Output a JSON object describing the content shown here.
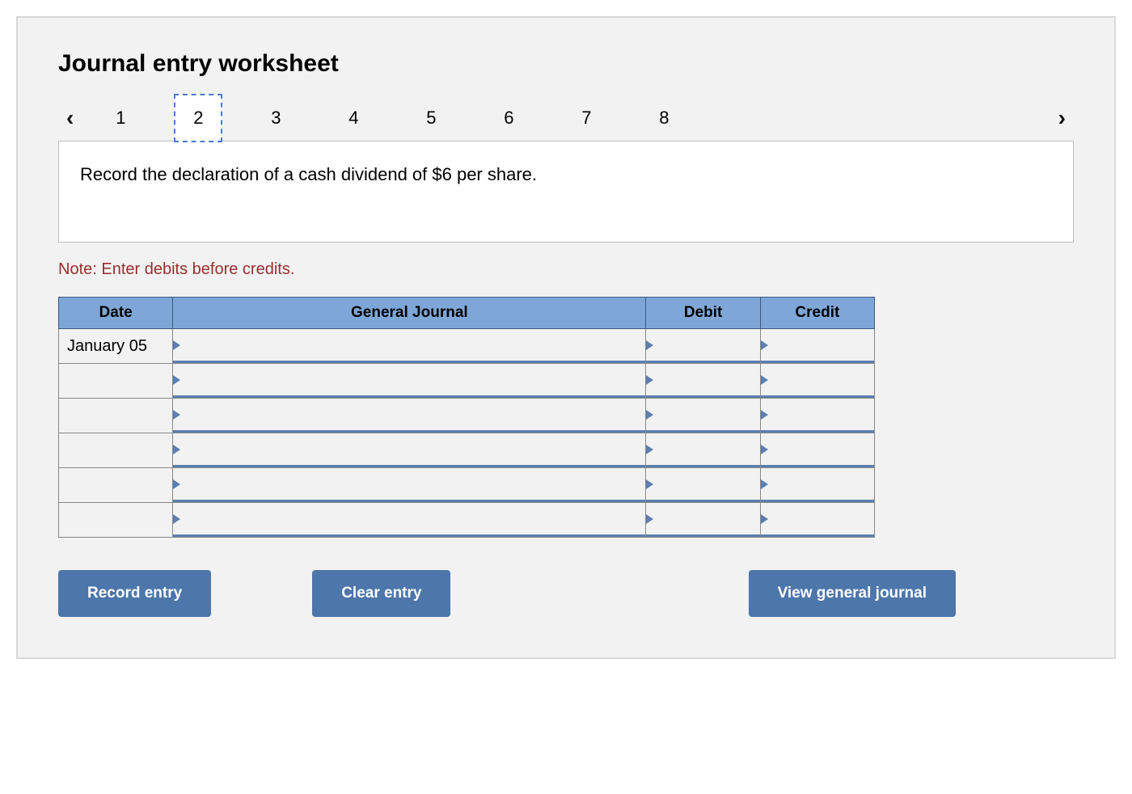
{
  "title": "Journal entry worksheet",
  "nav": {
    "steps": [
      "1",
      "2",
      "3",
      "4",
      "5",
      "6",
      "7",
      "8"
    ],
    "active_index": 1
  },
  "prompt": "Record the declaration of a cash dividend of $6 per share.",
  "note": "Note: Enter debits before credits.",
  "table": {
    "headers": {
      "date": "Date",
      "journal": "General Journal",
      "debit": "Debit",
      "credit": "Credit"
    },
    "rows": [
      {
        "date": "January 05",
        "journal": "",
        "debit": "",
        "credit": ""
      },
      {
        "date": "",
        "journal": "",
        "debit": "",
        "credit": ""
      },
      {
        "date": "",
        "journal": "",
        "debit": "",
        "credit": ""
      },
      {
        "date": "",
        "journal": "",
        "debit": "",
        "credit": ""
      },
      {
        "date": "",
        "journal": "",
        "debit": "",
        "credit": ""
      },
      {
        "date": "",
        "journal": "",
        "debit": "",
        "credit": ""
      }
    ]
  },
  "buttons": {
    "record": "Record entry",
    "clear": "Clear entry",
    "view": "View general journal"
  }
}
